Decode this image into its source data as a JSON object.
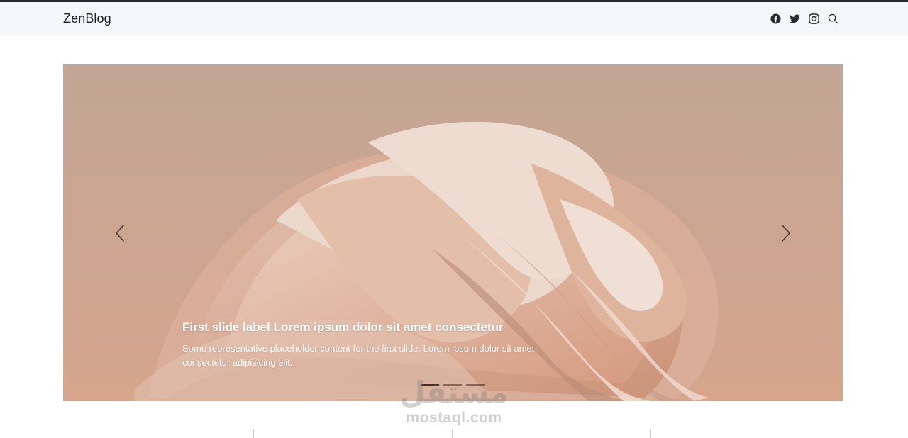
{
  "navbar": {
    "brand": "ZenBlog",
    "icons": [
      "facebook-icon",
      "twitter-icon",
      "instagram-icon",
      "search-icon"
    ]
  },
  "carousel": {
    "slides_count": 3,
    "active_slide": 1,
    "caption": {
      "title": "First slide label Lorem ipsum dolor sit amet consectetur",
      "text": "Some representative placeholder content for the first slide. Lorem ipsum dolor sit amet consectetur adipisicing elit."
    },
    "controls": {
      "prev_icon": "chevron-left-icon",
      "next_icon": "chevron-right-icon"
    }
  },
  "watermark": {
    "logo": "مستقل",
    "text": "mostaql.com"
  },
  "colors": {
    "navbar_bg": "#f6f7f9",
    "slide_base": "#c9a896",
    "caption_text": "#ffffff"
  }
}
